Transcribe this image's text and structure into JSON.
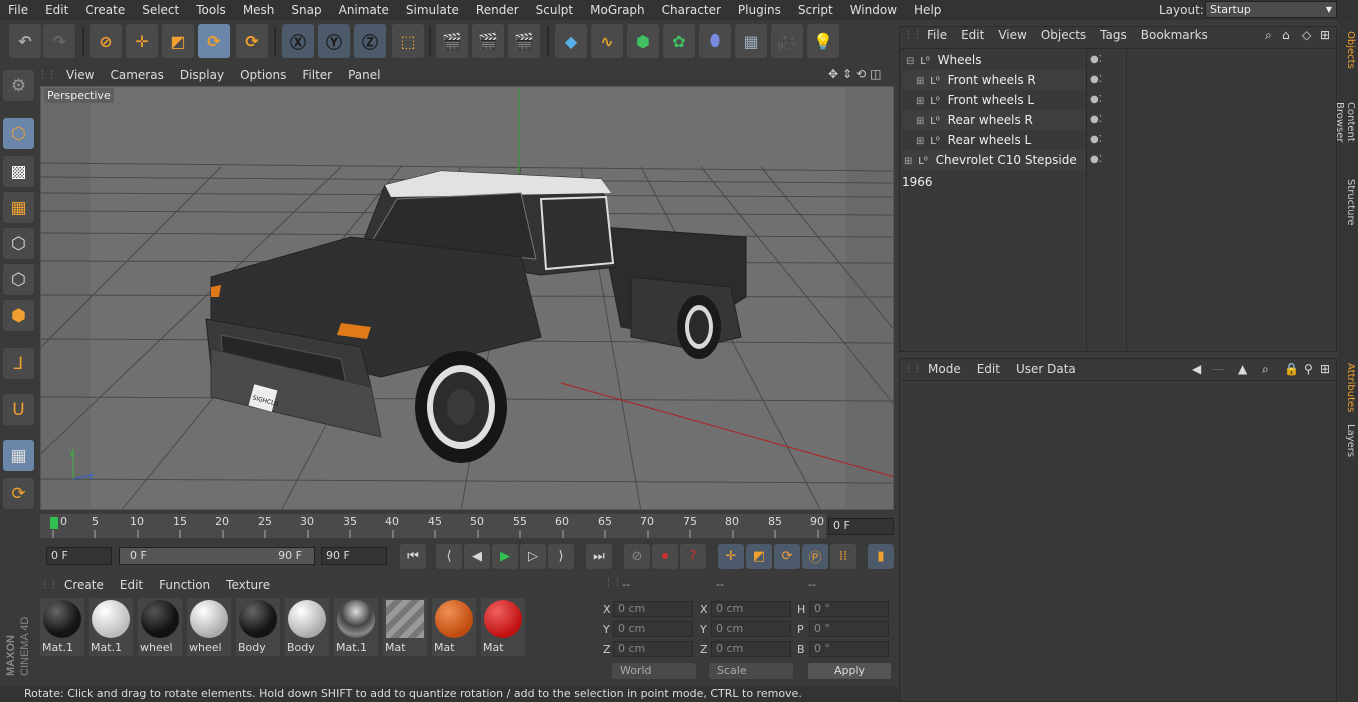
{
  "menubar": {
    "items": [
      "File",
      "Edit",
      "Create",
      "Select",
      "Tools",
      "Mesh",
      "Snap",
      "Animate",
      "Simulate",
      "Render",
      "Sculpt",
      "MoGraph",
      "Character",
      "Plugins",
      "Script",
      "Window",
      "Help"
    ],
    "layout_label": "Layout:",
    "layout_value": "Startup"
  },
  "viewport": {
    "menu": [
      "View",
      "Cameras",
      "Display",
      "Options",
      "Filter",
      "Panel"
    ],
    "label": "Perspective"
  },
  "timeline": {
    "ticks": [
      "0",
      "5",
      "10",
      "15",
      "20",
      "25",
      "30",
      "35",
      "40",
      "45",
      "50",
      "55",
      "60",
      "65",
      "70",
      "75",
      "80",
      "85",
      "90"
    ],
    "current_frame": "0 F",
    "start_field": "0 F",
    "range_start": "0 F",
    "range_end": "90 F",
    "end_field": "90 F"
  },
  "materials": {
    "menu": [
      "Create",
      "Edit",
      "Function",
      "Texture"
    ],
    "items": [
      {
        "label": "Mat.1",
        "color": "#141414"
      },
      {
        "label": "Mat.1",
        "color": "#e8e8e8"
      },
      {
        "label": "wheel",
        "color": "#111111"
      },
      {
        "label": "wheel",
        "color": "#dcdcdc"
      },
      {
        "label": "Body",
        "color": "#141414"
      },
      {
        "label": "Body",
        "color": "#d8d8d8"
      },
      {
        "label": "Mat.1",
        "color": "#7a7a7a"
      },
      {
        "label": "Mat",
        "color": "#888888"
      },
      {
        "label": "Mat",
        "color": "#d86018"
      },
      {
        "label": "Mat",
        "color": "#d41c1c"
      }
    ]
  },
  "coords": {
    "headers": [
      "--",
      "--",
      "--"
    ],
    "rows": [
      {
        "a": "X",
        "av": "0 cm",
        "b": "X",
        "bv": "0 cm",
        "c": "H",
        "cv": "0 °"
      },
      {
        "a": "Y",
        "av": "0 cm",
        "b": "Y",
        "bv": "0 cm",
        "c": "P",
        "cv": "0 °"
      },
      {
        "a": "Z",
        "av": "0 cm",
        "b": "Z",
        "bv": "0 cm",
        "c": "B",
        "cv": "0 °"
      }
    ],
    "world": "World",
    "scale": "Scale",
    "apply": "Apply"
  },
  "status": "Rotate: Click and drag to rotate elements. Hold down SHIFT to add to quantize rotation / add to the selection in point mode, CTRL to remove.",
  "objects": {
    "menu": [
      "File",
      "Edit",
      "View",
      "Objects",
      "Tags",
      "Bookmarks"
    ],
    "tree": [
      "Wheels",
      "Front wheels R",
      "Front wheels L",
      "Rear wheels R",
      "Rear wheels L",
      "Chevrolet C10 Stepside 1966"
    ]
  },
  "attributes": {
    "menu": [
      "Mode",
      "Edit",
      "User Data"
    ]
  },
  "right_tabs": [
    "Objects",
    "Content Browser",
    "Structure",
    "Attributes",
    "Layers"
  ],
  "brand": "MAXON CINEMA 4D",
  "license_plate": "SIGHCLU",
  "colors": {
    "accent": "#f0a030",
    "selected": "#6a86a8"
  }
}
